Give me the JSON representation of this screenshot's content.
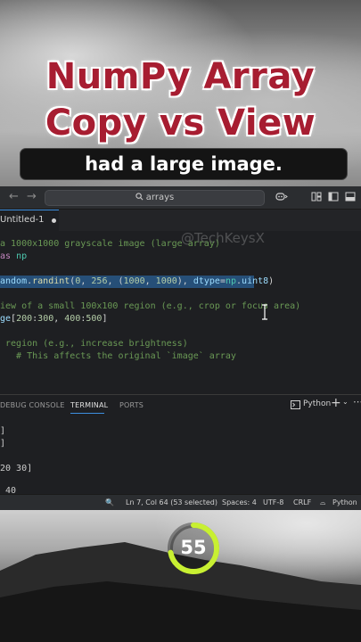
{
  "overlay": {
    "title_line1": "NumPy Array",
    "title_line2": "Copy vs View",
    "caption": "had a large image.",
    "watermark": "@TechKeysX",
    "timer_value": "55",
    "timer_progress": 0.72,
    "colors": {
      "title": "#a71d31",
      "ring": "#c8f032"
    }
  },
  "titlebar": {
    "search_text": "arrays",
    "icons": [
      "back-arrow",
      "forward-arrow",
      "search-icon",
      "copilot-icon",
      "layout-icon",
      "sidebar-icon",
      "panel-icon"
    ]
  },
  "editor": {
    "tab_label": "Untitled-1",
    "lines": [
      [
        {
          "t": "a 1000x1000 grayscale image (large array)",
          "c": "com"
        }
      ],
      [
        {
          "t": "as ",
          "c": "kw"
        },
        {
          "t": "np",
          "c": "mod"
        }
      ],
      [],
      [
        {
          "t": "andom",
          "c": "id"
        },
        {
          "t": ".",
          "c": "txt"
        },
        {
          "t": "randint",
          "c": "fn"
        },
        {
          "t": "(",
          "c": "txt"
        },
        {
          "t": "0",
          "c": "num"
        },
        {
          "t": ", ",
          "c": "txt"
        },
        {
          "t": "256",
          "c": "num"
        },
        {
          "t": ", (",
          "c": "txt"
        },
        {
          "t": "1000",
          "c": "num"
        },
        {
          "t": ", ",
          "c": "txt"
        },
        {
          "t": "1000",
          "c": "num"
        },
        {
          "t": "), ",
          "c": "txt"
        },
        {
          "t": "dtype",
          "c": "id"
        },
        {
          "t": "=",
          "c": "txt"
        },
        {
          "t": "np",
          "c": "mod"
        },
        {
          "t": ".",
          "c": "txt"
        },
        {
          "t": "uint8",
          "c": "id"
        },
        {
          "t": ")",
          "c": "txt"
        }
      ],
      [],
      [
        {
          "t": "iew of a small 100x100 region (e.g., crop or focus area)",
          "c": "com"
        }
      ],
      [
        {
          "t": "ge",
          "c": "id"
        },
        {
          "t": "[",
          "c": "txt"
        },
        {
          "t": "200",
          "c": "num"
        },
        {
          "t": ":",
          "c": "txt"
        },
        {
          "t": "300",
          "c": "num"
        },
        {
          "t": ", ",
          "c": "txt"
        },
        {
          "t": "400",
          "c": "num"
        },
        {
          "t": ":",
          "c": "txt"
        },
        {
          "t": "500",
          "c": "num"
        },
        {
          "t": "]",
          "c": "txt"
        }
      ],
      [],
      [
        {
          "t": " region (e.g., increase brightness)",
          "c": "com"
        }
      ],
      [
        {
          "t": "   # This affects the original `image` array",
          "c": "com"
        }
      ]
    ]
  },
  "panel": {
    "tabs": [
      "DEBUG CONSOLE",
      "TERMINAL",
      "PORTS"
    ],
    "active_tab": "TERMINAL",
    "shell": "Python",
    "plus": "+",
    "terminal_lines": [
      "]",
      "]",
      "",
      "20 30]",
      "",
      " 40"
    ]
  },
  "statusbar": {
    "position": "Ln 7, Col 64 (53 selected)",
    "spaces": "Spaces: 4",
    "encoding": "UTF-8",
    "eol": "CRLF",
    "language": "Python"
  }
}
